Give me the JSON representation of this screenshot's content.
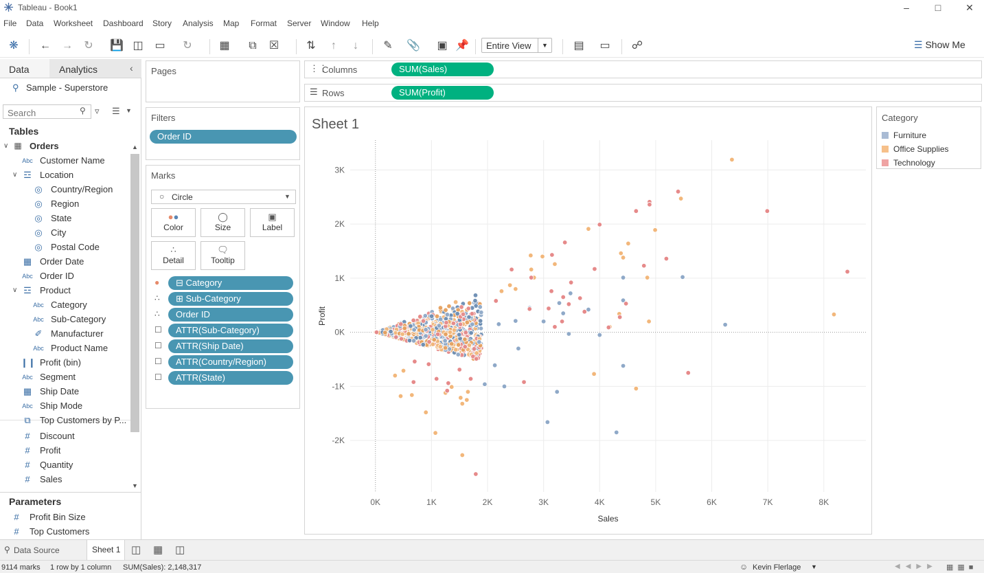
{
  "window": {
    "title": "Tableau - Book1",
    "controls": [
      "–",
      "□",
      "✕"
    ]
  },
  "menu": [
    "File",
    "Data",
    "Worksheet",
    "Dashboard",
    "Story",
    "Analysis",
    "Map",
    "Format",
    "Server",
    "Window",
    "Help"
  ],
  "toolbar": {
    "fit_label": "Entire View",
    "show_me_label": "Show Me"
  },
  "left_pane": {
    "tabs": [
      "Data",
      "Analytics"
    ],
    "datasource": "Sample - Superstore",
    "search_placeholder": "Search",
    "tables_header": "Tables",
    "table_name": "Orders",
    "fields": [
      {
        "label": "Customer Name",
        "icon": "Abc",
        "indent": 1
      },
      {
        "label": "Location",
        "icon": "hierarchy",
        "indent": 1,
        "expanded": true
      },
      {
        "label": "Country/Region",
        "icon": "globe",
        "indent": 2
      },
      {
        "label": "Region",
        "icon": "globe",
        "indent": 2
      },
      {
        "label": "State",
        "icon": "globe",
        "indent": 2
      },
      {
        "label": "City",
        "icon": "globe",
        "indent": 2
      },
      {
        "label": "Postal Code",
        "icon": "globe",
        "indent": 2
      },
      {
        "label": "Order Date",
        "icon": "calendar",
        "indent": 1
      },
      {
        "label": "Order ID",
        "icon": "Abc",
        "indent": 1
      },
      {
        "label": "Product",
        "icon": "hierarchy",
        "indent": 1,
        "expanded": true
      },
      {
        "label": "Category",
        "icon": "Abc",
        "indent": 2
      },
      {
        "label": "Sub-Category",
        "icon": "Abc",
        "indent": 2
      },
      {
        "label": "Manufacturer",
        "icon": "paperclip",
        "indent": 2
      },
      {
        "label": "Product Name",
        "icon": "Abc",
        "indent": 2
      },
      {
        "label": "Profit (bin)",
        "icon": "bin",
        "indent": 1
      },
      {
        "label": "Segment",
        "icon": "Abc",
        "indent": 1
      },
      {
        "label": "Ship Date",
        "icon": "calendar",
        "indent": 1
      },
      {
        "label": "Ship Mode",
        "icon": "Abc",
        "indent": 1
      },
      {
        "label": "Top Customers by P...",
        "icon": "set",
        "indent": 1
      },
      {
        "label": "Discount",
        "icon": "#",
        "indent": 1
      },
      {
        "label": "Profit",
        "icon": "#",
        "indent": 1
      },
      {
        "label": "Quantity",
        "icon": "#",
        "indent": 1
      },
      {
        "label": "Sales",
        "icon": "#",
        "indent": 1
      }
    ],
    "parameters_header": "Parameters",
    "parameters": [
      "Profit Bin Size",
      "Top Customers"
    ]
  },
  "shelves": {
    "pages_label": "Pages",
    "filters_label": "Filters",
    "filters": [
      "Order ID"
    ],
    "marks_label": "Marks",
    "mark_type": "Circle",
    "mark_buttons": [
      "Color",
      "Size",
      "Label",
      "Detail",
      "Tooltip"
    ],
    "mark_pills": [
      {
        "label": "Category",
        "kind": "color",
        "prefix": "⊟"
      },
      {
        "label": "Sub-Category",
        "kind": "detail",
        "prefix": "⊞"
      },
      {
        "label": "Order ID",
        "kind": "detail",
        "prefix": ""
      },
      {
        "label": "ATTR(Sub-Category)",
        "kind": "tooltip",
        "prefix": ""
      },
      {
        "label": "ATTR(Ship Date)",
        "kind": "tooltip",
        "prefix": ""
      },
      {
        "label": "ATTR(Country/Region)",
        "kind": "tooltip",
        "prefix": ""
      },
      {
        "label": "ATTR(State)",
        "kind": "tooltip",
        "prefix": ""
      }
    ],
    "columns_label": "Columns",
    "columns_pill": "SUM(Sales)",
    "rows_label": "Rows",
    "rows_pill": "SUM(Profit)"
  },
  "sheet": {
    "title": "Sheet 1"
  },
  "legend": {
    "title": "Category",
    "items": [
      {
        "label": "Furniture",
        "color": "#a9bbd4"
      },
      {
        "label": "Office Supplies",
        "color": "#f6c08a"
      },
      {
        "label": "Technology",
        "color": "#efa3a3"
      }
    ]
  },
  "chart_data": {
    "type": "scatter",
    "title": "",
    "xlabel": "Sales",
    "ylabel": "Profit",
    "xlim": [
      -450,
      8750
    ],
    "ylim": [
      -2950,
      3550
    ],
    "x_ticks": [
      "0K",
      "1K",
      "2K",
      "3K",
      "4K",
      "5K",
      "6K",
      "7K",
      "8K"
    ],
    "y_ticks": [
      "3K",
      "2K",
      "1K",
      "0K",
      "-1K",
      "-2K"
    ],
    "grid": true,
    "legend_position": "right",
    "series": [
      {
        "name": "Furniture",
        "color": "#8fa9c8",
        "points": [
          [
            5480,
            1020
          ],
          [
            4420,
            1010
          ],
          [
            3480,
            720
          ],
          [
            3280,
            540
          ],
          [
            3350,
            350
          ],
          [
            3800,
            420
          ],
          [
            4420,
            590
          ],
          [
            6240,
            140
          ],
          [
            3450,
            -30
          ],
          [
            4000,
            -50
          ],
          [
            4420,
            -620
          ],
          [
            3240,
            -1100
          ],
          [
            3070,
            -1660
          ],
          [
            4300,
            -1850
          ],
          [
            2300,
            -1000
          ],
          [
            1950,
            -960
          ],
          [
            2130,
            -610
          ],
          [
            2550,
            -300
          ],
          [
            1850,
            -180
          ],
          [
            2750,
            450
          ],
          [
            3000,
            200
          ],
          [
            2500,
            210
          ],
          [
            2200,
            150
          ]
        ]
      },
      {
        "name": "Office Supplies",
        "color": "#f2b77b",
        "points": [
          [
            6360,
            3190
          ],
          [
            5450,
            2470
          ],
          [
            4990,
            1890
          ],
          [
            3800,
            1910
          ],
          [
            4510,
            1640
          ],
          [
            4380,
            1460
          ],
          [
            4420,
            1380
          ],
          [
            4850,
            1010
          ],
          [
            2400,
            870
          ],
          [
            2770,
            1420
          ],
          [
            2980,
            1400
          ],
          [
            3200,
            1260
          ],
          [
            2780,
            1160
          ],
          [
            2830,
            1010
          ],
          [
            8180,
            330
          ],
          [
            4880,
            200
          ],
          [
            4350,
            340
          ],
          [
            4180,
            100
          ],
          [
            3900,
            -770
          ],
          [
            4650,
            -1040
          ],
          [
            1650,
            -1100
          ],
          [
            1630,
            -1250
          ],
          [
            1550,
            -1320
          ],
          [
            1520,
            -1210
          ],
          [
            1360,
            -1010
          ],
          [
            1070,
            -1860
          ],
          [
            900,
            -1480
          ],
          [
            650,
            -1160
          ],
          [
            450,
            -1180
          ],
          [
            350,
            -800
          ],
          [
            500,
            -710
          ],
          [
            1550,
            -2270
          ],
          [
            1250,
            -1120
          ],
          [
            2250,
            760
          ],
          [
            2500,
            800
          ]
        ]
      },
      {
        "name": "Technology",
        "color": "#e68a8a",
        "points": [
          [
            6990,
            2240
          ],
          [
            8420,
            1120
          ],
          [
            5400,
            2600
          ],
          [
            4890,
            2410
          ],
          [
            4890,
            2360
          ],
          [
            4650,
            2240
          ],
          [
            4000,
            1990
          ],
          [
            3380,
            1660
          ],
          [
            4790,
            1230
          ],
          [
            5190,
            1360
          ],
          [
            3910,
            1170
          ],
          [
            3150,
            1430
          ],
          [
            2430,
            1160
          ],
          [
            2780,
            1010
          ],
          [
            3490,
            920
          ],
          [
            3140,
            760
          ],
          [
            3350,
            650
          ],
          [
            3650,
            630
          ],
          [
            3450,
            520
          ],
          [
            3730,
            380
          ],
          [
            4470,
            530
          ],
          [
            4360,
            280
          ],
          [
            3090,
            440
          ],
          [
            3330,
            200
          ],
          [
            4160,
            90
          ],
          [
            5580,
            -750
          ],
          [
            2650,
            -920
          ],
          [
            1790,
            -2620
          ],
          [
            1280,
            -1080
          ],
          [
            1090,
            -860
          ],
          [
            1300,
            -940
          ],
          [
            680,
            -920
          ],
          [
            950,
            -590
          ],
          [
            1500,
            -690
          ],
          [
            1700,
            -860
          ],
          [
            700,
            -540
          ],
          [
            1800,
            -490
          ],
          [
            2150,
            580
          ],
          [
            3200,
            100
          ],
          [
            2750,
            430
          ]
        ]
      }
    ],
    "bulk_note": ""
  },
  "status_bar": {
    "marks": "9114 marks",
    "dims": "1 row by 1 column",
    "sum": "SUM(Sales): 2,148,317",
    "user": "Kevin Flerlage"
  },
  "sheet_tabs": {
    "data_source": "Data Source",
    "active": "Sheet 1"
  }
}
